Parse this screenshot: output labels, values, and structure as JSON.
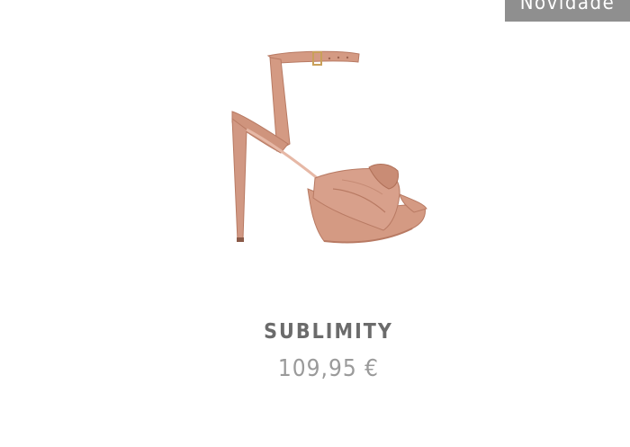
{
  "badge": {
    "label": "Novidade"
  },
  "product": {
    "name": "SUBLIMITY",
    "price": "109,95 €",
    "image_icon": "sandal-image"
  },
  "colors": {
    "badge_bg": "#8f8f8f",
    "shoe_main": "#d49a83",
    "shoe_dark": "#b87a63",
    "name_text": "#6b6b6b",
    "price_text": "#9a9a9a"
  }
}
